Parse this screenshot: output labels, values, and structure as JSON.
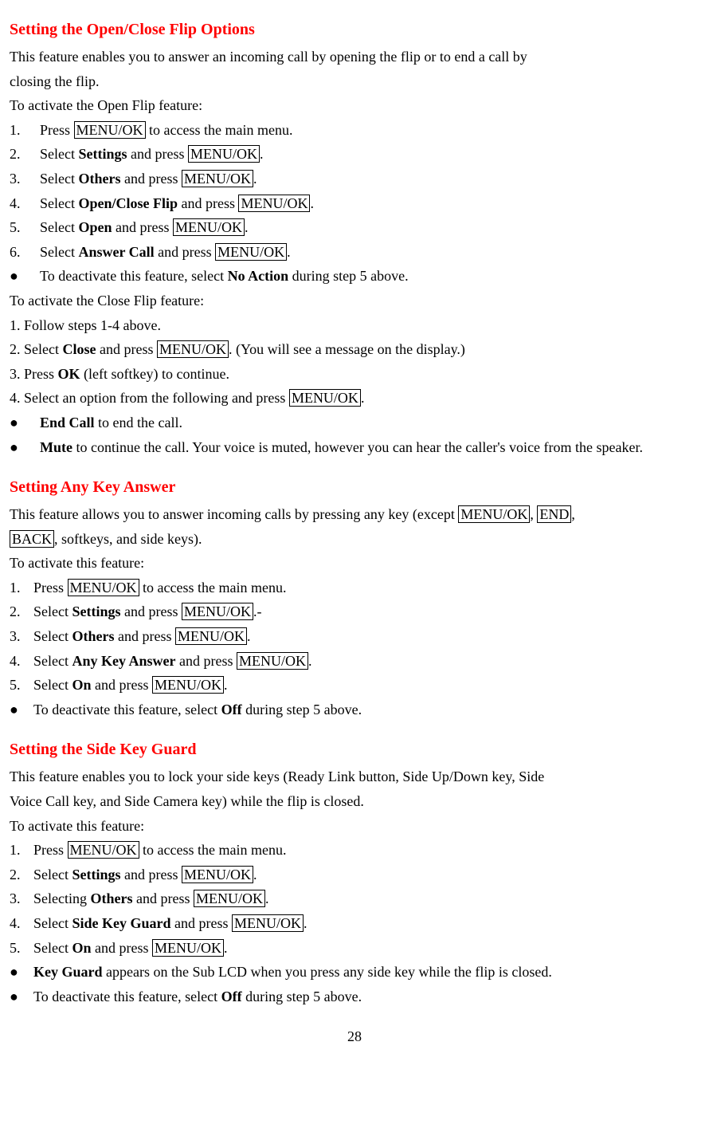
{
  "s1": {
    "heading": "Setting the Open/Close Flip Options",
    "intro1": "This feature enables you to answer an incoming call by opening the flip or to end a call by",
    "intro2": "closing the flip.",
    "activateOpen": "To activate the Open Flip feature:",
    "step1_num": "1.",
    "step1_a": "Press ",
    "step1_b": "MENU/OK",
    "step1_c": " to access the main menu.",
    "step2_num": "2.",
    "step2_a": "Select ",
    "step2_b": "Settings",
    "step2_c": " and press ",
    "step2_d": "MENU/OK",
    "step2_e": ".",
    "step3_num": "3.",
    "step3_a": "Select ",
    "step3_b": "Others",
    "step3_c": " and press ",
    "step3_d": "MENU/OK",
    "step3_e": ".",
    "step4_num": "4.",
    "step4_a": "Select ",
    "step4_b": "Open/Close Flip",
    "step4_c": " and press ",
    "step4_d": "MENU/OK",
    "step4_e": ".",
    "step5_num": "5.",
    "step5_a": "Select ",
    "step5_b": "Open",
    "step5_c": " and press ",
    "step5_d": "MENU/OK",
    "step5_e": ".",
    "step6_num": "6.",
    "step6_a": "Select ",
    "step6_b": "Answer Call",
    "step6_c": " and press ",
    "step6_d": "MENU/OK",
    "step6_e": ".",
    "bullet1_a": "To deactivate this feature, select ",
    "bullet1_b": "No Action",
    "bullet1_c": " during step 5 above.",
    "activateClose": "To activate the Close Flip feature:",
    "close1": "1. Follow steps 1-4 above.",
    "close2_a": "2. Select ",
    "close2_b": "Close",
    "close2_c": " and press ",
    "close2_d": "MENU/OK",
    "close2_e": ". (You will see a message on the display.)",
    "close3_a": "3. Press ",
    "close3_b": "OK",
    "close3_c": " (left softkey) to continue.",
    "close4_a": "4. Select an option from the following and press ",
    "close4_b": "MENU/OK",
    "close4_c": ".",
    "bullet2_a": "End Call",
    "bullet2_b": " to end the call.",
    "bullet3_a": "Mute",
    "bullet3_b": " to continue the call. Your voice is muted, however you can hear the caller's voice from the speaker."
  },
  "s2": {
    "heading": "Setting Any Key Answer",
    "intro_a": "This feature allows you to answer incoming calls by pressing any key (except ",
    "intro_b": "MENU/OK",
    "intro_c": ", ",
    "intro_d": "END",
    "intro_e": ", ",
    "intro_f": "BACK",
    "intro_g": ", softkeys, and side keys).",
    "activate": "To activate this feature:",
    "step1_num": "1.",
    "step1_a": "Press ",
    "step1_b": "MENU/OK",
    "step1_c": " to access the main menu.",
    "step2_num": "2.",
    "step2_a": "Select ",
    "step2_b": "Settings",
    "step2_c": " and press ",
    "step2_d": "MENU/OK",
    "step2_e": ".-",
    "step3_num": "3.",
    "step3_a": "Select ",
    "step3_b": "Others",
    "step3_c": " and press ",
    "step3_d": "MENU/OK",
    "step3_e": ".",
    "step4_num": "4.",
    "step4_a": "Select ",
    "step4_b": "Any Key Answer",
    "step4_c": " and press ",
    "step4_d": "MENU/OK",
    "step4_e": ".",
    "step5_num": "5.",
    "step5_a": "Select ",
    "step5_b": "On",
    "step5_c": " and press ",
    "step5_d": "MENU/OK",
    "step5_e": ".",
    "bullet1_a": "To deactivate this feature, select ",
    "bullet1_b": "Off",
    "bullet1_c": " during step 5 above."
  },
  "s3": {
    "heading": "Setting the Side Key Guard",
    "intro1": "This feature enables you to lock your side keys (Ready Link button, Side Up/Down key, Side",
    "intro2": "Voice Call key, and Side Camera key) while the flip is closed.",
    "activate": "To activate this feature:",
    "step1_num": "1.",
    "step1_a": "Press ",
    "step1_b": "MENU/OK",
    "step1_c": " to access the main menu.",
    "step2_num": "2.",
    "step2_a": "Select ",
    "step2_b": "Settings",
    "step2_c": " and press ",
    "step2_d": "MENU/OK",
    "step2_e": ".",
    "step3_num": "3.",
    "step3_a": "Selecting ",
    "step3_b": "Others",
    "step3_c": " and press ",
    "step3_d": "MENU/OK",
    "step3_e": ".",
    "step4_num": "4.",
    "step4_a": "Select ",
    "step4_b": "Side Key Guard",
    "step4_c": " and press ",
    "step4_d": "MENU/OK",
    "step4_e": ".",
    "step5_num": "5.",
    "step5_a": "Select ",
    "step5_b": "On",
    "step5_c": " and press ",
    "step5_d": "MENU/OK",
    "step5_e": ".",
    "bullet1_a": "Key Guard",
    "bullet1_b": " appears on the Sub LCD when you press any side key while the flip is closed.",
    "bullet2_a": "To deactivate this feature, select ",
    "bullet2_b": "Off",
    "bullet2_c": " during step 5 above."
  },
  "pageNum": "28",
  "bullet": "●"
}
